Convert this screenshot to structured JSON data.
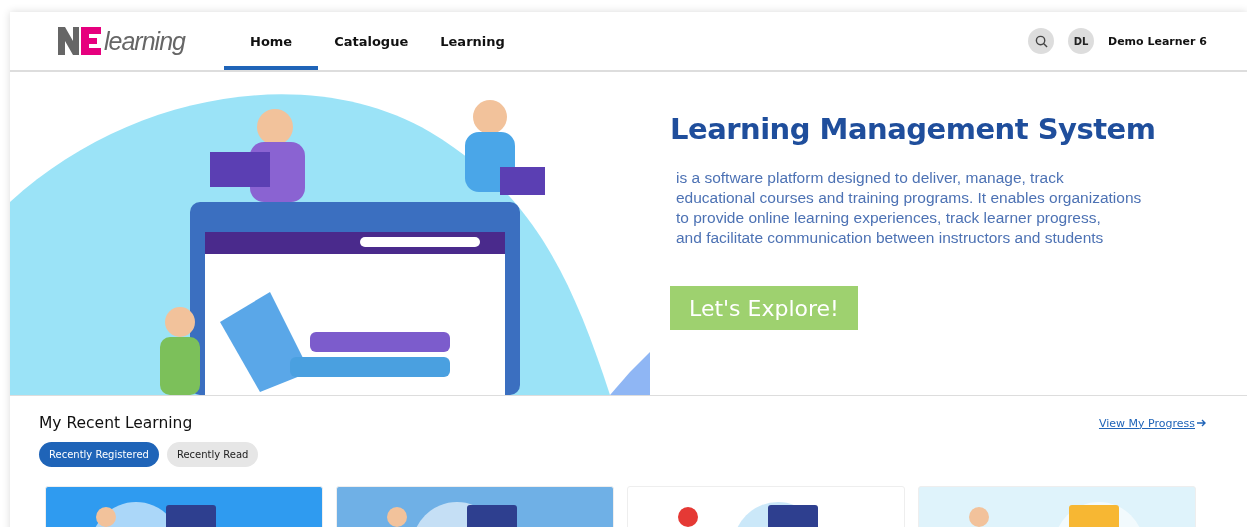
{
  "header": {
    "logo_text": "learning",
    "nav": [
      {
        "label": "Home",
        "selected": true
      },
      {
        "label": "Catalogue",
        "selected": false
      },
      {
        "label": "Learning",
        "selected": false
      }
    ],
    "user": {
      "initials": "DL",
      "name": "Demo Learner 6"
    }
  },
  "banner": {
    "title": "Learning Management System",
    "lines": [
      "is a software platform designed to deliver, manage, track",
      "educational courses and training programs. It enables organizations",
      "to provide online learning experiences, track learner progress,",
      "and facilitate communication between instructors and students"
    ],
    "button": "Let's Explore!"
  },
  "recent": {
    "title": "My Recent Learning",
    "link": "View My Progress",
    "tabs": [
      {
        "label": "Recently Registered",
        "selected": true
      },
      {
        "label": "Recently Read",
        "selected": false
      }
    ]
  }
}
